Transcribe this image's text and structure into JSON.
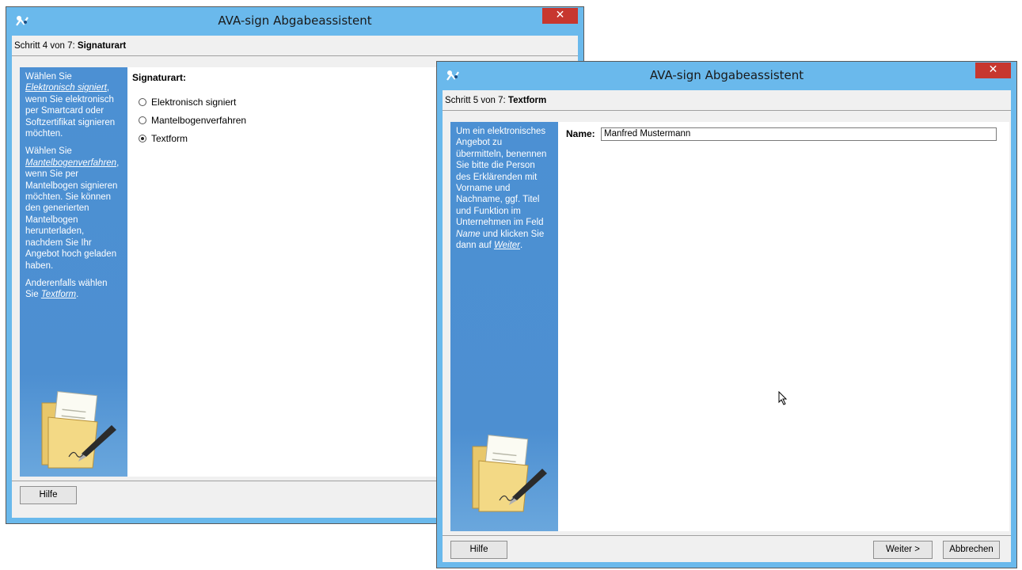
{
  "colors": {
    "titlebar": "#6ab9ec",
    "side_panel": "#4a8fd2",
    "close_button": "#c7372f"
  },
  "window_back": {
    "app_icon": "ava-logo-icon",
    "title": "AVA-sign Abgabeassistent",
    "close_label": "✕",
    "step_prefix": "Schritt 4 von 7: ",
    "step_title": "Signaturart",
    "side": {
      "p1_a": "Wählen Sie ",
      "p1_em": "Elektronisch signiert",
      "p1_b": ", wenn Sie elektronisch per Smartcard oder Softzertifikat signieren möchten.",
      "p2_a": "Wählen Sie ",
      "p2_em": "Mantelbogenverfahren",
      "p2_b": ", wenn Sie per Mantelbogen signieren möchten. Sie können den generierten Mantelbogen herunterladen, nachdem Sie Ihr Angebot hoch geladen haben.",
      "p3_a": "Anderenfalls wählen Sie ",
      "p3_em": "Textform",
      "p3_b": "."
    },
    "heading": "Signaturart:",
    "options": [
      {
        "label": "Elektronisch signiert",
        "checked": false
      },
      {
        "label": "Mantelbogenverfahren",
        "checked": false
      },
      {
        "label": "Textform",
        "checked": true
      }
    ],
    "help_label": "Hilfe"
  },
  "window_front": {
    "app_icon": "ava-logo-icon",
    "title": "AVA-sign Abgabeassistent",
    "close_label": "✕",
    "step_prefix": "Schritt 5 von 7: ",
    "step_title": "Textform",
    "side": {
      "t_a": "Um ein elektronisches Angebot zu übermitteln, benennen Sie bitte die Person des Erklärenden mit Vorname und Nachname, ggf. Titel und Funktion im Unternehmen im Feld ",
      "t_em1": "Name",
      "t_b": " und klicken Sie dann auf ",
      "t_em2": "Weiter",
      "t_c": "."
    },
    "name_label": "Name:",
    "name_value": "Manfred Mustermann",
    "help_label": "Hilfe",
    "next_label": "Weiter >",
    "cancel_label": "Abbrechen"
  }
}
